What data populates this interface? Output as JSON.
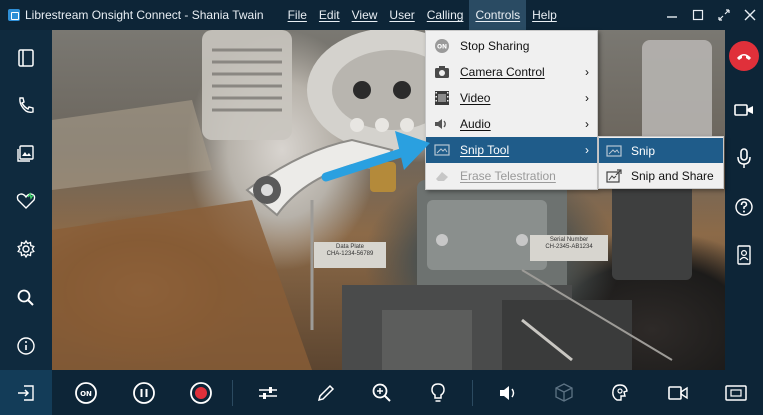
{
  "window": {
    "title": "Librestream Onsight Connect - Shania Twain"
  },
  "menubar": [
    {
      "label": "File"
    },
    {
      "label": "Edit"
    },
    {
      "label": "View"
    },
    {
      "label": "User"
    },
    {
      "label": "Calling"
    },
    {
      "label": "Controls"
    },
    {
      "label": "Help"
    }
  ],
  "window_controls": {
    "minimize_icon": "minimize-icon",
    "maximize_icon": "maximize-icon",
    "expand_icon": "expand-icon",
    "close_icon": "close-icon"
  },
  "controls_menu": {
    "items": [
      {
        "label": "Stop Sharing",
        "icon": "on-badge-icon",
        "has_submenu": false
      },
      {
        "label": "Camera Control",
        "icon": "camera-icon",
        "has_submenu": true
      },
      {
        "label": "Video",
        "icon": "film-icon",
        "has_submenu": true
      },
      {
        "label": "Audio",
        "icon": "speaker-icon",
        "has_submenu": true
      },
      {
        "label": "Snip Tool",
        "icon": "snip-icon",
        "has_submenu": true,
        "highlighted": true
      },
      {
        "label": "Erase Telestration",
        "icon": "eraser-icon",
        "has_submenu": false,
        "disabled": true
      }
    ]
  },
  "snip_submenu": {
    "items": [
      {
        "label": "Snip",
        "icon": "snip-icon",
        "highlighted": true
      },
      {
        "label": "Snip and Share",
        "icon": "snip-share-icon"
      }
    ]
  },
  "left_sidebar": [
    {
      "icon": "panel-icon"
    },
    {
      "icon": "phone-icon"
    },
    {
      "icon": "gallery-icon"
    },
    {
      "icon": "heart-pulse-icon"
    },
    {
      "icon": "settings-icon"
    },
    {
      "icon": "search-icon"
    },
    {
      "icon": "info-icon"
    }
  ],
  "right_sidebar": [
    {
      "icon": "end-call-icon"
    },
    {
      "icon": "video-camera-icon"
    },
    {
      "icon": "microphone-icon"
    },
    {
      "icon": "help-icon"
    },
    {
      "icon": "participant-icon"
    }
  ],
  "bottom_toolbar": [
    {
      "icon": "exit-icon"
    },
    {
      "icon": "on-icon"
    },
    {
      "icon": "pause-icon"
    },
    {
      "icon": "record-icon"
    },
    {
      "icon": "adjust-sliders-icon"
    },
    {
      "icon": "pen-icon"
    },
    {
      "icon": "zoom-in-icon"
    },
    {
      "icon": "light-bulb-icon"
    },
    {
      "icon": "volume-icon"
    },
    {
      "icon": "3d-cube-icon"
    },
    {
      "icon": "thermal-icon"
    },
    {
      "icon": "video-camera-icon"
    },
    {
      "icon": "fullscreen-icon"
    }
  ],
  "colors": {
    "chrome_dark": "#0d2537",
    "menu_highlight": "#1f5c8a",
    "record_red": "#e0303a",
    "annotation_arrow": "#2aa0e0"
  },
  "video_labels": {
    "left_tag": "Data Plate\nCHA-1234-56789",
    "right_tag": "Serial Number\nCH-2345-AB1234"
  }
}
